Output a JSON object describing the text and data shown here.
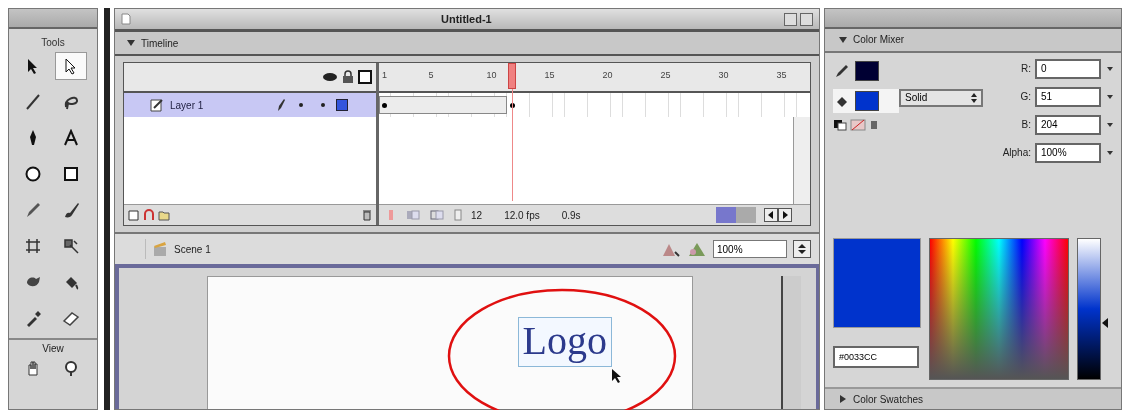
{
  "tools_panel": {
    "title": "Tools",
    "tools": [
      {
        "kind": "arrow",
        "selected": false
      },
      {
        "kind": "subselect",
        "selected": true
      },
      {
        "kind": "line",
        "selected": false
      },
      {
        "kind": "lasso",
        "selected": false
      },
      {
        "kind": "pen",
        "selected": false
      },
      {
        "kind": "text",
        "selected": false
      },
      {
        "kind": "oval",
        "selected": false
      },
      {
        "kind": "rect",
        "selected": false
      },
      {
        "kind": "pencil",
        "selected": false
      },
      {
        "kind": "brush",
        "selected": false
      },
      {
        "kind": "transform",
        "selected": false
      },
      {
        "kind": "fill-transform",
        "selected": false
      },
      {
        "kind": "ink",
        "selected": false
      },
      {
        "kind": "bucket",
        "selected": false
      },
      {
        "kind": "dropper",
        "selected": false
      },
      {
        "kind": "eraser",
        "selected": false
      }
    ],
    "view": {
      "label": "View",
      "tools": [
        {
          "kind": "hand",
          "selected": false
        },
        {
          "kind": "zoom",
          "selected": false
        }
      ]
    }
  },
  "document": {
    "title": "Untitled-1",
    "timeline": {
      "title": "Timeline",
      "layers": [
        {
          "name": "Layer 1",
          "selected": true
        }
      ],
      "frame_numbers": [
        "1",
        "5",
        "10",
        "15",
        "20",
        "25",
        "30",
        "35"
      ],
      "current_frame": "12",
      "frame_rate": "12.0 fps",
      "elapsed": "0.9s"
    },
    "scene": {
      "name": "Scene 1",
      "zoom": "100%"
    },
    "stage": {
      "logo": "Logo"
    }
  },
  "color_mixer": {
    "title": "Color Mixer",
    "fill_type": "Solid",
    "stroke": {
      "color": "#000033"
    },
    "fill": {
      "color": "#0033cc",
      "selected": true
    },
    "channels": [
      {
        "label": "R:",
        "value": "0"
      },
      {
        "label": "G:",
        "value": "51"
      },
      {
        "label": "B:",
        "value": "204"
      },
      {
        "label": "Alpha:",
        "value": "100%"
      }
    ],
    "hex": "#0033CC",
    "brightness": {
      "level": 0.4
    }
  },
  "color_swatches": {
    "title": "Color Swatches",
    "expanded": false
  }
}
